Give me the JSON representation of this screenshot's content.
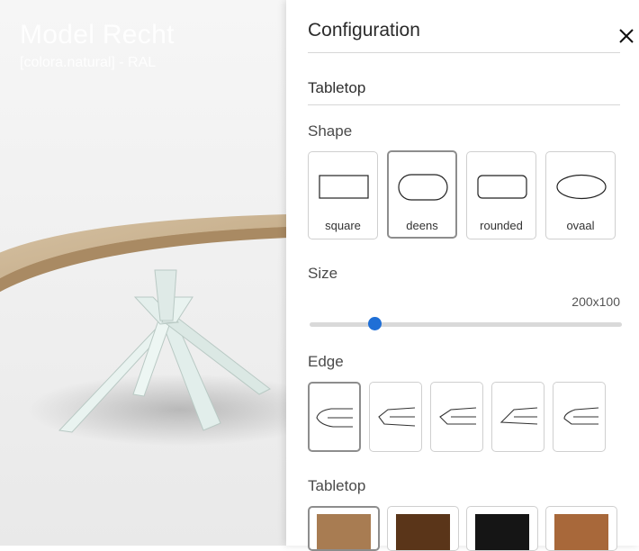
{
  "preview": {
    "model_title": "Model Recht",
    "model_subtitle": "[colora.natural] - RAL"
  },
  "panel": {
    "title": "Configuration",
    "close_icon": "close-icon",
    "tabletop_heading": "Tabletop",
    "shape": {
      "label": "Shape",
      "options": [
        {
          "label": "square",
          "icon": "rectangle-shape-icon",
          "selected": false
        },
        {
          "label": "deens",
          "icon": "rounded-oval-shape-icon",
          "selected": true
        },
        {
          "label": "rounded",
          "icon": "rounded-rectangle-shape-icon",
          "selected": false
        },
        {
          "label": "ovaal",
          "icon": "ellipse-shape-icon",
          "selected": false
        }
      ]
    },
    "size": {
      "label": "Size",
      "value": "200x100",
      "slider_fraction": 0.21
    },
    "edge": {
      "label": "Edge",
      "options": [
        {
          "icon": "edge-profile-1-icon",
          "selected": true
        },
        {
          "icon": "edge-profile-2-icon",
          "selected": false
        },
        {
          "icon": "edge-profile-3-icon",
          "selected": false
        },
        {
          "icon": "edge-profile-4-icon",
          "selected": false
        },
        {
          "icon": "edge-profile-5-icon",
          "selected": false
        }
      ]
    },
    "tabletop_material": {
      "label": "Tabletop",
      "swatches": [
        {
          "color": "#a87c52",
          "selected": true
        },
        {
          "color": "#5a3519",
          "selected": false
        },
        {
          "color": "#151515",
          "selected": false
        },
        {
          "color": "#a8683a",
          "selected": false
        }
      ]
    }
  },
  "colors": {
    "accent": "#1f6fd6",
    "table_top": "#c9b394",
    "table_leg": "#e6f1ee"
  }
}
